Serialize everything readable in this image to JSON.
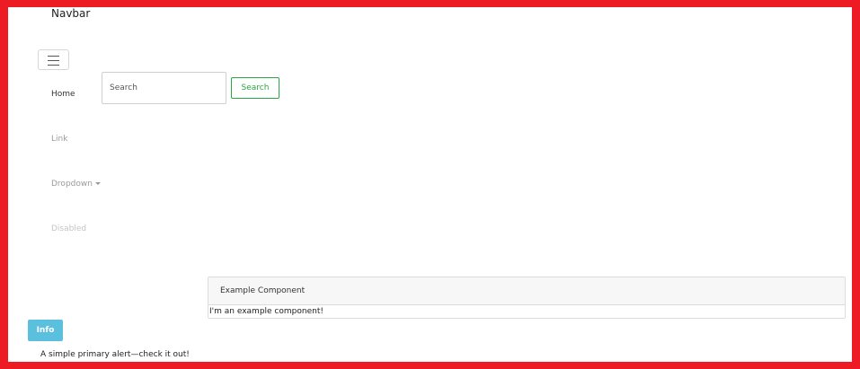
{
  "navbar": {
    "brand": "Navbar",
    "items": [
      {
        "label": "Home"
      },
      {
        "label": "Link"
      },
      {
        "label": "Dropdown"
      },
      {
        "label": "Disabled"
      }
    ],
    "search": {
      "placeholder": "Search",
      "button_label": "Search"
    }
  },
  "card": {
    "header": "Example Component",
    "body": "I'm an example component!"
  },
  "info_button": {
    "label": "Info"
  },
  "alert": {
    "text": "A simple primary alert—check it out!"
  },
  "colors": {
    "frame_border": "#ed1c24",
    "success": "#28a745",
    "info": "#5bc0de"
  },
  "icons": [
    "hamburger-menu-icon",
    "caret-down-icon"
  ]
}
